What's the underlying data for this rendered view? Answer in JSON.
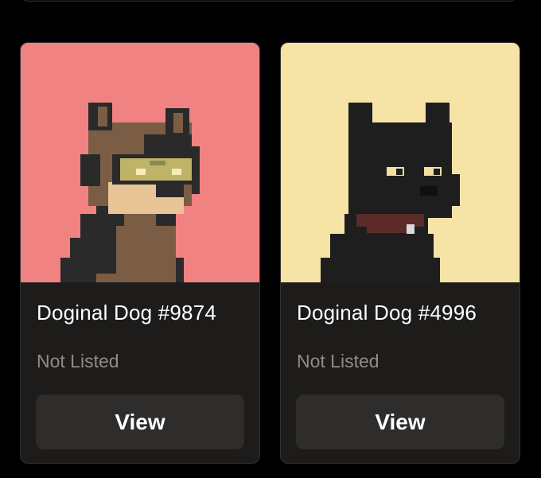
{
  "cards": [
    {
      "title": "Doginal Dog #9874",
      "status": "Not Listed",
      "button_label": "View",
      "background_color": "#f08282",
      "image_icon": "pixel-dog-brown-with-goggles-icon"
    },
    {
      "title": "Doginal Dog #4996",
      "status": "Not Listed",
      "button_label": "View",
      "background_color": "#f6e3a6",
      "image_icon": "pixel-dog-black-with-collar-icon"
    }
  ],
  "colors": {
    "page_background": "#000000",
    "card_background": "#1d1c1b",
    "button_background": "#2e2d2b",
    "title_text": "#ffffff",
    "status_text": "#8f8c88"
  }
}
